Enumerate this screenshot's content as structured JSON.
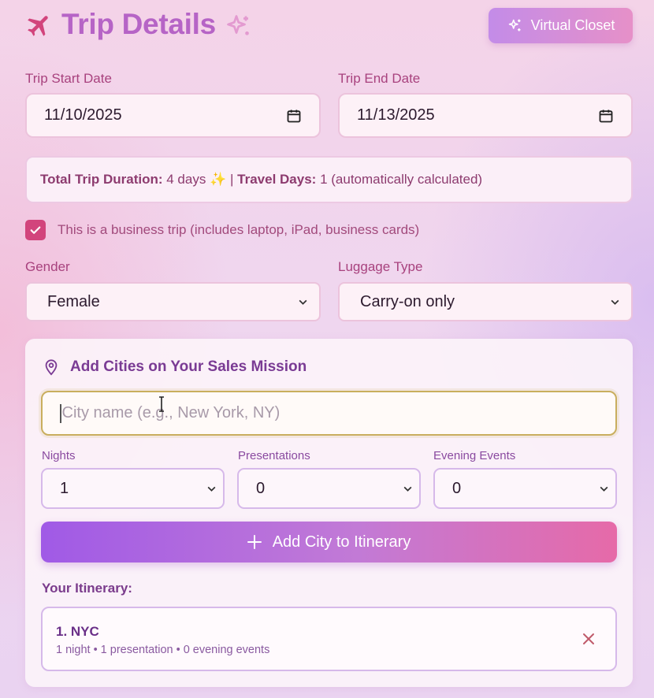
{
  "header": {
    "title": "Trip Details",
    "virtual_closet_label": "Virtual Closet",
    "icons": [
      "plane-icon",
      "sparkles-icon"
    ]
  },
  "trip_dates": {
    "start_label": "Trip Start Date",
    "start_value": "11/10/2025",
    "end_label": "Trip End Date",
    "end_value": "11/13/2025"
  },
  "duration": {
    "total_label": "Total Trip Duration:",
    "total_value": "4 days",
    "separator": "|",
    "travel_label": "Travel Days:",
    "travel_value": "1",
    "note": "(automatically calculated)"
  },
  "business_trip": {
    "checked": true,
    "label": "This is a business trip (includes laptop, iPad, business cards)"
  },
  "gender": {
    "label": "Gender",
    "value": "Female"
  },
  "luggage": {
    "label": "Luggage Type",
    "value": "Carry-on only"
  },
  "cities": {
    "title": "Add Cities on Your Sales Mission",
    "city_placeholder": "City name (e.g., New York, NY)",
    "nights_label": "Nights",
    "nights_value": "1",
    "presentations_label": "Presentations",
    "presentations_value": "0",
    "evening_label": "Evening Events",
    "evening_value": "0",
    "add_button_label": "Add City to Itinerary"
  },
  "itinerary": {
    "label": "Your Itinerary:",
    "items": [
      {
        "name": "1. NYC",
        "details": "1 night • 1 presentation • 0 evening events"
      }
    ]
  },
  "colors": {
    "title": "#b664c6",
    "accent_pink": "#d2447c",
    "button_gradient_start": "#a05ae6",
    "button_gradient_end": "#e66aa8"
  }
}
